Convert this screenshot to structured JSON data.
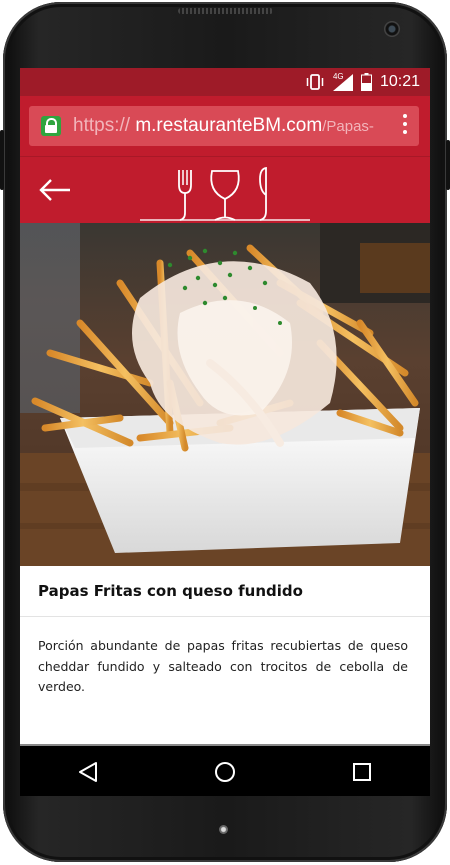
{
  "status_bar": {
    "signal_label": "4G",
    "time": "10:21",
    "icons": [
      "vibrate-icon",
      "signal-icon",
      "battery-icon"
    ]
  },
  "browser": {
    "url_scheme": "https://",
    "url_host": "m.restauranteBM.com",
    "url_path": "/Papas-"
  },
  "app_header": {
    "back_icon": "arrow-left-icon",
    "logo": "fork-glass-knife-logo"
  },
  "dish": {
    "title": "Papas Fritas con queso fundido",
    "description": "Porción abundante de papas fritas recubiertas de queso cheddar fundido y salteado con trocitos de cebolla de verdeo.",
    "image": "french-fries-with-melted-cheese-photo"
  },
  "nav_bar": {
    "icons": [
      "back-triangle-icon",
      "home-circle-icon",
      "recents-square-icon"
    ]
  },
  "colors": {
    "primary": "#c01c2d",
    "status_bar": "#9e1b28",
    "url_field": "#d94a56",
    "lock": "#2fa53f"
  }
}
